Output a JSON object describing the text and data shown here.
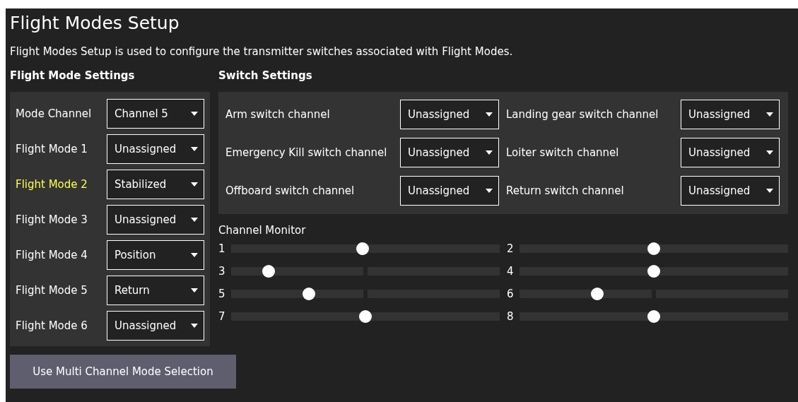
{
  "title": "Flight Modes Setup",
  "description": "Flight Modes Setup is used to configure the transmitter switches associated with Flight Modes.",
  "flight_mode_settings": {
    "heading": "Flight Mode Settings",
    "rows": [
      {
        "label": "Mode Channel",
        "value": "Channel 5",
        "active": false
      },
      {
        "label": "Flight Mode 1",
        "value": "Unassigned",
        "active": false
      },
      {
        "label": "Flight Mode 2",
        "value": "Stabilized",
        "active": true
      },
      {
        "label": "Flight Mode 3",
        "value": "Unassigned",
        "active": false
      },
      {
        "label": "Flight Mode 4",
        "value": "Position",
        "active": false
      },
      {
        "label": "Flight Mode 5",
        "value": "Return",
        "active": false
      },
      {
        "label": "Flight Mode 6",
        "value": "Unassigned",
        "active": false
      }
    ]
  },
  "switch_settings": {
    "heading": "Switch Settings",
    "rows": [
      {
        "label": "Arm switch channel",
        "value": "Unassigned"
      },
      {
        "label": "Landing gear switch channel",
        "value": "Unassigned"
      },
      {
        "label": "Emergency Kill switch channel",
        "value": "Unassigned"
      },
      {
        "label": "Loiter switch channel",
        "value": "Unassigned"
      },
      {
        "label": "Offboard switch channel",
        "value": "Unassigned"
      },
      {
        "label": "Return switch channel",
        "value": "Unassigned"
      }
    ]
  },
  "channel_monitor": {
    "heading": "Channel Monitor",
    "channels": [
      {
        "label": "1",
        "level": 0.49
      },
      {
        "label": "2",
        "level": 0.5
      },
      {
        "label": "3",
        "level": 0.14,
        "split": true
      },
      {
        "label": "4",
        "level": 0.5
      },
      {
        "label": "5",
        "level": 0.29,
        "split": true
      },
      {
        "label": "6",
        "level": 0.29,
        "split": true
      },
      {
        "label": "7",
        "level": 0.5
      },
      {
        "label": "8",
        "level": 0.5
      }
    ]
  },
  "button": "Use Multi Channel Mode Selection"
}
